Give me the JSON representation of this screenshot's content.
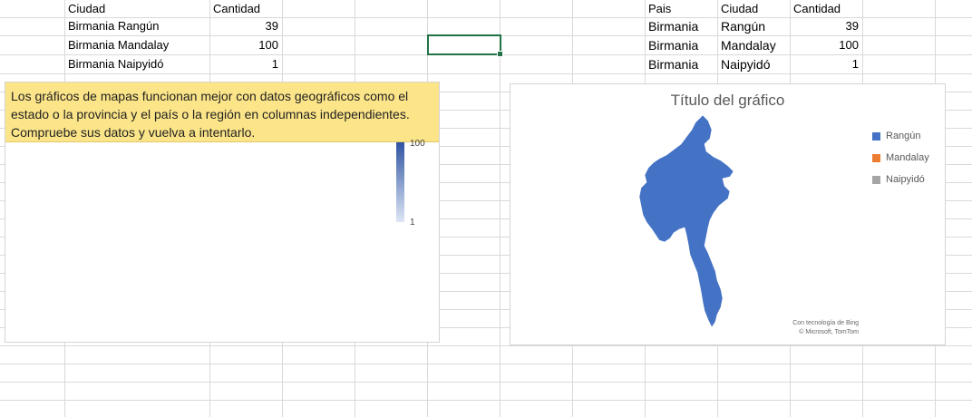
{
  "sheet": {
    "left_table": {
      "headers": [
        "Ciudad",
        "Cantidad"
      ],
      "rows": [
        {
          "ciudad": "Birmania Rangún",
          "cantidad": "39"
        },
        {
          "ciudad": "Birmania Mandalay",
          "cantidad": "100"
        },
        {
          "ciudad": "Birmania Naipyidó",
          "cantidad": "1"
        }
      ]
    },
    "right_table": {
      "headers": [
        "Pais",
        "Ciudad",
        "Cantidad"
      ],
      "rows": [
        {
          "pais": "Birmania",
          "ciudad": "Rangún",
          "cantidad": "39"
        },
        {
          "pais": "Birmania",
          "ciudad": "Mandalay",
          "cantidad": "100"
        },
        {
          "pais": "Birmania",
          "ciudad": "Naipyidó",
          "cantidad": "1"
        }
      ]
    }
  },
  "left_chart": {
    "warning": "Los gráficos de mapas funcionan mejor con datos geográficos como el estado o la provincia y el país o la región en columnas independientes. Compruebe sus datos y vuelva a intentarlo.",
    "scale_max": "100",
    "scale_min": "1"
  },
  "right_chart": {
    "title": "Título del gráfico",
    "legend": [
      {
        "label": "Rangún",
        "color": "#4472c4"
      },
      {
        "label": "Mandalay",
        "color": "#ed7d31"
      },
      {
        "label": "Naipyidó",
        "color": "#a5a5a5"
      }
    ],
    "credit_line1": "Con tecnología de Bing",
    "credit_line2": "© Microsoft, TomTom",
    "map_fill": "#4472c4"
  }
}
